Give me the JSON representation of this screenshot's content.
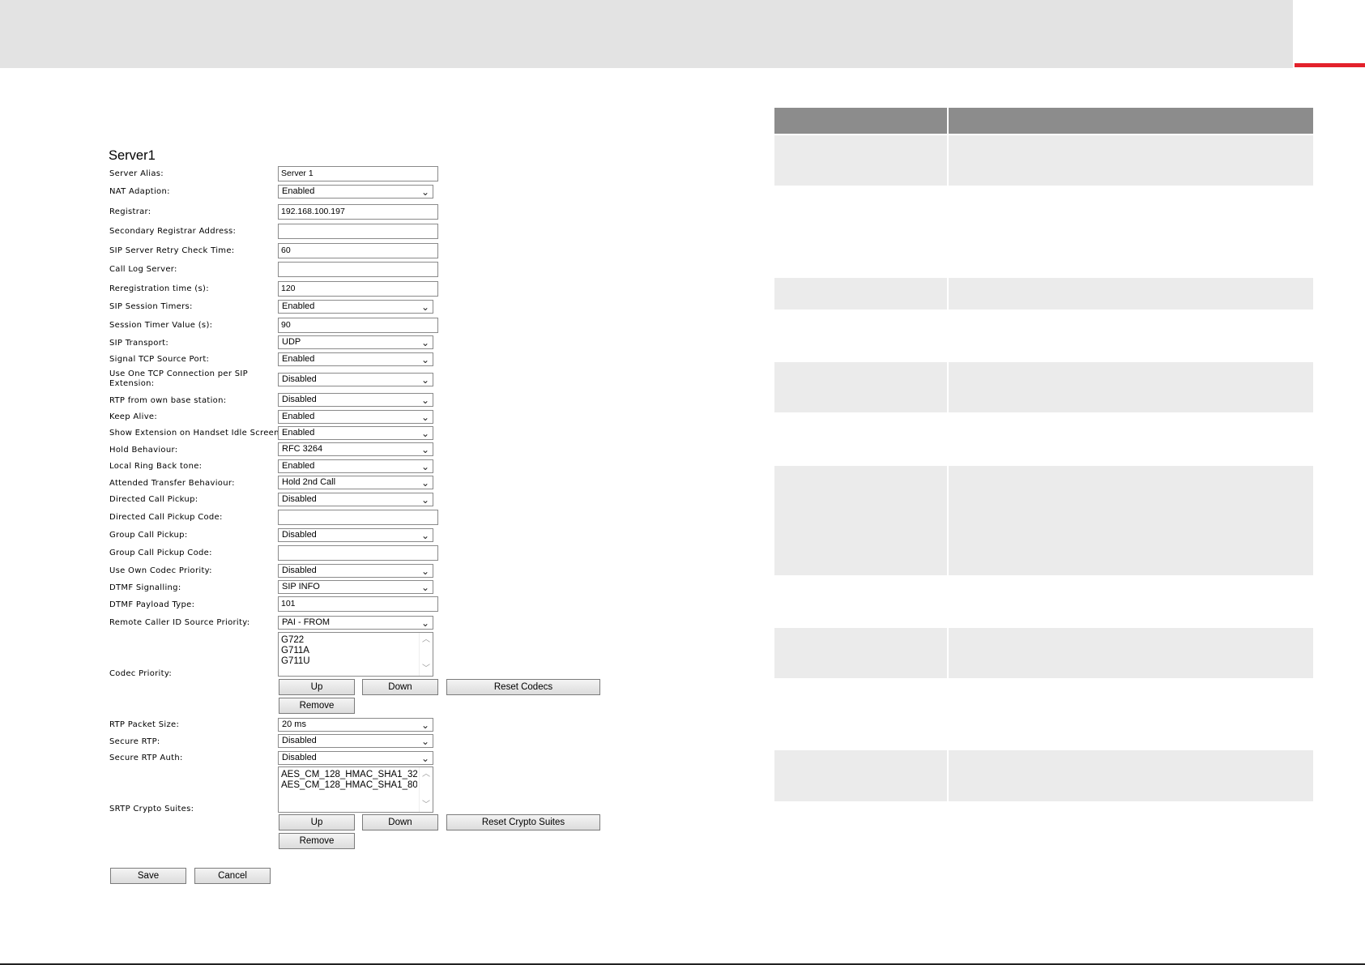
{
  "form": {
    "title": "Server1",
    "fields": {
      "server_alias": {
        "label": "Server Alias:",
        "value": "Server 1"
      },
      "nat_adaption": {
        "label": "NAT Adaption:",
        "value": "Enabled"
      },
      "registrar": {
        "label": "Registrar:",
        "value": "192.168.100.197"
      },
      "secondary_registrar": {
        "label": "Secondary Registrar Address:",
        "value": ""
      },
      "sip_retry": {
        "label": "SIP Server Retry Check Time:",
        "value": "60"
      },
      "call_log_server": {
        "label": "Call Log Server:",
        "value": ""
      },
      "reregistration": {
        "label": "Reregistration time (s):",
        "value": "120"
      },
      "sip_session_timers": {
        "label": "SIP Session Timers:",
        "value": "Enabled"
      },
      "session_timer_value": {
        "label": "Session Timer Value (s):",
        "value": "90"
      },
      "sip_transport": {
        "label": "SIP Transport:",
        "value": "UDP"
      },
      "signal_tcp": {
        "label": "Signal TCP Source Port:",
        "value": "Enabled"
      },
      "one_tcp": {
        "label": "Use One TCP Connection per SIP Extension:",
        "value": "Disabled"
      },
      "rtp_own_base": {
        "label": "RTP from own base station:",
        "value": "Disabled"
      },
      "keep_alive": {
        "label": "Keep Alive:",
        "value": "Enabled"
      },
      "show_extension": {
        "label": "Show Extension on Handset Idle Screen:",
        "value": "Enabled"
      },
      "hold_behaviour": {
        "label": "Hold Behaviour:",
        "value": "RFC 3264"
      },
      "local_ring_back": {
        "label": "Local Ring Back tone:",
        "value": "Enabled"
      },
      "attended_transfer": {
        "label": "Attended Transfer Behaviour:",
        "value": "Hold 2nd Call"
      },
      "directed_pickup": {
        "label": "Directed Call Pickup:",
        "value": "Disabled"
      },
      "directed_pickup_code": {
        "label": "Directed Call Pickup Code:",
        "value": ""
      },
      "group_pickup": {
        "label": "Group Call Pickup:",
        "value": "Disabled"
      },
      "group_pickup_code": {
        "label": "Group Call Pickup Code:",
        "value": ""
      },
      "own_codec_priority": {
        "label": "Use Own Codec Priority:",
        "value": "Disabled"
      },
      "dtmf_signalling": {
        "label": "DTMF Signalling:",
        "value": "SIP INFO"
      },
      "dtmf_payload": {
        "label": "DTMF Payload Type:",
        "value": "101"
      },
      "remote_caller_id": {
        "label": "Remote Caller ID Source Priority:",
        "value": "PAI - FROM"
      },
      "codec_priority": {
        "label": "Codec Priority:",
        "options": [
          "G722",
          "G711A",
          "G711U"
        ]
      },
      "rtp_packet_size": {
        "label": "RTP Packet Size:",
        "value": "20 ms"
      },
      "secure_rtp": {
        "label": "Secure RTP:",
        "value": "Disabled"
      },
      "secure_rtp_auth": {
        "label": "Secure RTP Auth:",
        "value": "Disabled"
      },
      "srtp_crypto": {
        "label": "SRTP Crypto Suites:",
        "options": [
          "AES_CM_128_HMAC_SHA1_32",
          "AES_CM_128_HMAC_SHA1_80"
        ]
      }
    },
    "buttons": {
      "up": "Up",
      "down": "Down",
      "reset_codecs": "Reset Codecs",
      "remove": "Remove",
      "reset_crypto": "Reset Crypto Suites",
      "save": "Save",
      "cancel": "Cancel"
    }
  },
  "colors": {
    "top_bar": "#e3e3e3",
    "accent": "#e3212b",
    "table_header": "#8c8c8c",
    "table_row": "#ebebeb"
  }
}
